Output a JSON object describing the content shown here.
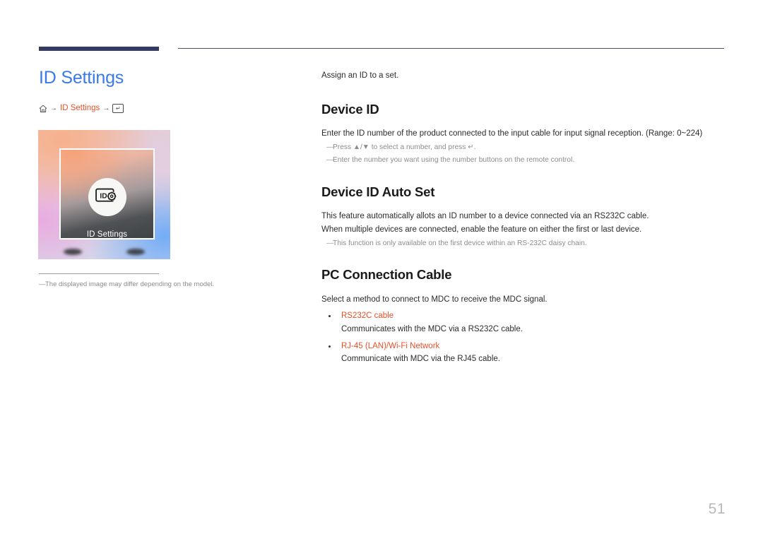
{
  "page": {
    "title": "ID Settings",
    "number": "51"
  },
  "breadcrumb": {
    "home_icon": "home-icon",
    "arrow": "→",
    "label": "ID Settings",
    "enter_key_icon": "↵"
  },
  "thumbnail": {
    "screen_label": "ID Settings",
    "icon_text": "ID",
    "icon_name": "id-settings-display-gear-icon"
  },
  "footnote": {
    "dash": "―",
    "text": "The displayed image may differ depending on the model."
  },
  "content": {
    "lead": "Assign an ID to a set.",
    "sections": [
      {
        "heading": "Device ID",
        "lines": [
          "Enter the ID number of the product connected to the input cable for input signal reception. (Range: 0~224)"
        ],
        "notes": [
          "Press ▲/▼ to select a number, and press ↵.",
          "Enter the number you want using the number buttons on the remote control."
        ]
      },
      {
        "heading": "Device ID Auto Set",
        "lines": [
          "This feature automatically allots an ID number to a device connected via an RS232C cable.",
          "When multiple devices are connected, enable the feature on either the first or last device."
        ],
        "notes": [
          "This function is only available on the first device within an RS-232C daisy chain."
        ]
      },
      {
        "heading": "PC Connection Cable",
        "lines": [
          "Select a method to connect to MDC to receive the MDC signal."
        ],
        "bullets": [
          {
            "title": "RS232C cable",
            "desc": "Communicates with the MDC via a RS232C cable."
          },
          {
            "title": "RJ-45 (LAN)/Wi-Fi Network",
            "desc": "Communicate with MDC via the RJ45 cable."
          }
        ]
      }
    ]
  },
  "colors": {
    "title_blue": "#3a7ae8",
    "accent_orange": "#e8502a",
    "rule_navy": "#353a5f",
    "note_gray": "#8c8c8c",
    "page_number_gray": "#b9b9b9"
  }
}
